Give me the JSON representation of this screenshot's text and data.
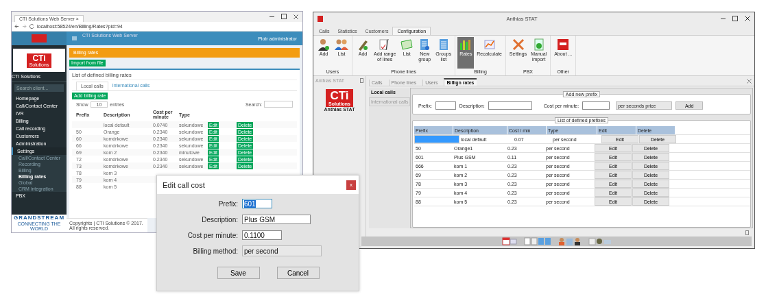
{
  "browser": {
    "tab_title": "CTI Solutions Web Server",
    "tab_close": "×",
    "url": "localhost:58524/en/Billing/Rates?pid=94",
    "header_title": "CTI Solutions Web Server",
    "user": "Piotr administrator",
    "logo": {
      "text": "CTi",
      "sub": "Solutions"
    },
    "company": "CTI Solutions",
    "search_placeholder": "Search client...",
    "menu": [
      {
        "label": "Homepage",
        "expanded": false
      },
      {
        "label": "Call/Contact Center",
        "expanded": false
      },
      {
        "label": "IVR",
        "expanded": false
      },
      {
        "label": "Billing",
        "expanded": false
      },
      {
        "label": "Call recording",
        "expanded": false
      },
      {
        "label": "Customers",
        "expanded": false
      },
      {
        "label": "Administration",
        "expanded": false
      },
      {
        "label": "Settings",
        "expanded": true,
        "children": [
          {
            "label": "Call/Contact Center",
            "selected": false
          },
          {
            "label": "Recording",
            "selected": false
          },
          {
            "label": "Billing",
            "selected": false
          },
          {
            "label": "Billing rates",
            "selected": true
          },
          {
            "label": "Global",
            "selected": false
          },
          {
            "label": "CRM integration",
            "selected": false
          }
        ]
      },
      {
        "label": "PBX",
        "expanded": false
      }
    ],
    "partner": {
      "name": "GRANDSTREAM",
      "tagline": "CONNECTING THE WORLD"
    },
    "alert": "Billing rates",
    "import_button": "Import from file",
    "panel_title": "List of defined billing rates",
    "tabs": [
      {
        "label": "Local calls",
        "selected": true
      },
      {
        "label": "International calls",
        "selected": false
      }
    ],
    "add_button": "Add billing rate",
    "show": "Show",
    "page_size": "10",
    "entries": "entries",
    "search_label": "Search:",
    "columns": [
      "Prefix",
      "Description",
      "Cost per minute",
      "Type"
    ],
    "rows": [
      {
        "prefix": "",
        "description": "local default",
        "cost": "0.0740",
        "type": "sekundowe",
        "edit": "Edit",
        "delete": "Delete"
      },
      {
        "prefix": "50",
        "description": "Orange",
        "cost": "0.2340",
        "type": "sekundowe",
        "edit": "Edit",
        "delete": "Delete"
      },
      {
        "prefix": "60",
        "description": "komórkowe",
        "cost": "0.2340",
        "type": "sekundowe",
        "edit": "Edit",
        "delete": "Delete"
      },
      {
        "prefix": "66",
        "description": "komórkowe",
        "cost": "0.2340",
        "type": "sekundowe",
        "edit": "Edit",
        "delete": "Delete"
      },
      {
        "prefix": "69",
        "description": "kom 2",
        "cost": "0.2340",
        "type": "minutowe",
        "edit": "Edit",
        "delete": "Delete"
      },
      {
        "prefix": "72",
        "description": "komórkowe",
        "cost": "0.2340",
        "type": "sekundowe",
        "edit": "Edit",
        "delete": "Delete"
      },
      {
        "prefix": "73",
        "description": "komórkowe",
        "cost": "0.2340",
        "type": "sekundowe",
        "edit": "Edit",
        "delete": "Delete"
      },
      {
        "prefix": "78",
        "description": "kom 3"
      },
      {
        "prefix": "79",
        "description": "kom 4"
      },
      {
        "prefix": "88",
        "description": "kom 5"
      }
    ],
    "footer": "Copyrights | CTI Solutions © 2017. All rights reserved."
  },
  "dialog": {
    "title": "Edit call cost",
    "close": "x",
    "fields": [
      {
        "label": "Prefix:",
        "value": "601",
        "kind": "selected-text"
      },
      {
        "label": "Description:",
        "value": "Plus GSM",
        "kind": "text"
      },
      {
        "label": "Cost per minute:",
        "value": "0.1100",
        "kind": "short-text"
      },
      {
        "label": "Billing method:",
        "value": "per second",
        "kind": "dropdown"
      }
    ],
    "buttons": [
      "Save",
      "Cancel"
    ]
  },
  "app": {
    "title": "Anthias STAT",
    "ribbon_tabs": [
      {
        "label": "Calls",
        "selected": false
      },
      {
        "label": "Statistics",
        "selected": false
      },
      {
        "label": "Customers",
        "selected": false
      },
      {
        "label": "Configuration",
        "selected": true
      }
    ],
    "ribbon_groups": [
      {
        "label": "Users",
        "buttons": [
          {
            "label": "Add",
            "selected": false
          },
          {
            "label": "List",
            "selected": false
          }
        ]
      },
      {
        "label": "Phone lines",
        "buttons": [
          {
            "label": "Add",
            "selected": false
          },
          {
            "label": "Add range\nof lines",
            "selected": false
          },
          {
            "label": "List",
            "selected": false
          },
          {
            "label": "New\ngroup",
            "selected": false
          },
          {
            "label": "Groups\nlist",
            "selected": false
          }
        ]
      },
      {
        "label": "Billing",
        "buttons": [
          {
            "label": "Rates",
            "selected": true
          },
          {
            "label": "Recalculate",
            "selected": false
          }
        ]
      },
      {
        "label": "PBX",
        "buttons": [
          {
            "label": "Settings",
            "selected": false
          },
          {
            "label": "Manual\nimport",
            "selected": false
          }
        ]
      },
      {
        "label": "Other",
        "buttons": [
          {
            "label": "About ...",
            "selected": false
          }
        ]
      }
    ],
    "side_title": "Anthias STAT",
    "logo": {
      "text": "CTi",
      "sub": "Solutions"
    },
    "logo_caption": "Anthias STAT",
    "doc_tabs": [
      {
        "label": "Calls",
        "selected": false
      },
      {
        "label": "Phone lines",
        "selected": false
      },
      {
        "label": "Users",
        "selected": false
      },
      {
        "label": "Billign rates",
        "selected": true
      }
    ],
    "side_tabs": [
      {
        "label": "Local calls",
        "selected": true
      },
      {
        "label": "International calls",
        "selected": false
      }
    ],
    "add_group": {
      "title": "Add new prefix",
      "prefix_label": "Prefix:",
      "description_label": "Description:",
      "cost_label": "Cost per minute:",
      "method": "per seconds price",
      "add_button": "Add"
    },
    "list_title": "List of defined prefixes",
    "columns": [
      "Prefix",
      "Description",
      "Cost / min",
      "Type",
      "Edit",
      "Delete"
    ],
    "rows": [
      {
        "prefix": "",
        "description": "local default",
        "cost": "0.07",
        "type": "per second",
        "selected": true,
        "edit": "Edit",
        "delete": "Delete"
      },
      {
        "prefix": "50",
        "description": "Orange1",
        "cost": "0.23",
        "type": "per second",
        "selected": false,
        "edit": "Edit",
        "delete": "Delete"
      },
      {
        "prefix": "601",
        "description": "Plus GSM",
        "cost": "0.11",
        "type": "per second",
        "selected": false,
        "edit": "Edit",
        "delete": "Delete"
      },
      {
        "prefix": "666",
        "description": "kom 1",
        "cost": "0.23",
        "type": "per second",
        "selected": false,
        "edit": "Edit",
        "delete": "Delete"
      },
      {
        "prefix": "69",
        "description": "kom 2",
        "cost": "0.23",
        "type": "per second",
        "selected": false,
        "edit": "Edit",
        "delete": "Delete"
      },
      {
        "prefix": "78",
        "description": "kom 3",
        "cost": "0.23",
        "type": "per second",
        "selected": false,
        "edit": "Edit",
        "delete": "Delete"
      },
      {
        "prefix": "79",
        "description": "kom 4",
        "cost": "0.23",
        "type": "per second",
        "selected": false,
        "edit": "Edit",
        "delete": "Delete"
      },
      {
        "prefix": "88",
        "description": "kom 5",
        "cost": "0.23",
        "type": "per second",
        "selected": false,
        "edit": "Edit",
        "delete": "Delete"
      }
    ]
  }
}
